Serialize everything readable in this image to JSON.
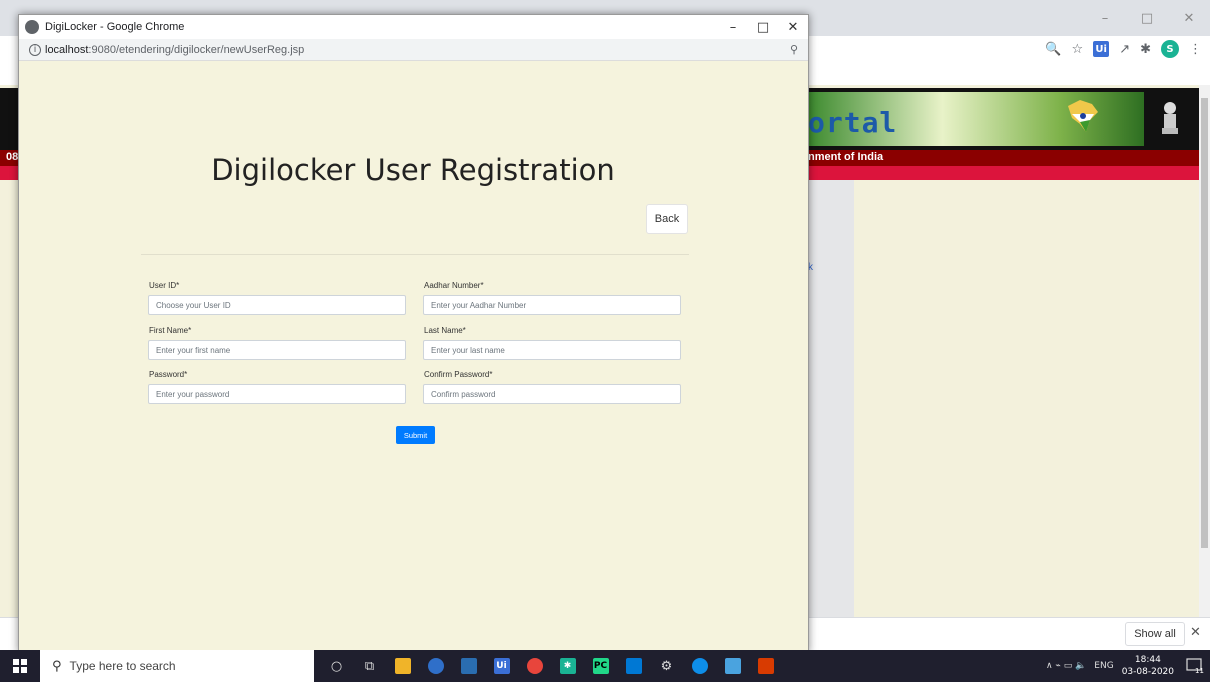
{
  "background_browser": {
    "window_controls": [
      "–",
      "□",
      "✕"
    ],
    "toolbar_icons": [
      "🔍",
      "☆",
      "Ui",
      "↗",
      "✱",
      "S",
      "⋮"
    ],
    "banner_text": "ortal",
    "gov_text": "nment of India",
    "left_clip": "08",
    "side_link": "k",
    "download_bar": {
      "show_all": "Show all",
      "close": "✕"
    }
  },
  "popup": {
    "title": "DigiLocker - Google Chrome",
    "controls": [
      "–",
      "□",
      "✕"
    ],
    "url_host": "localhost",
    "url_rest": ":9080/etendering/digilocker/newUserReg.jsp",
    "page_title": "Digilocker User Registration",
    "back_label": "Back",
    "form": {
      "user_id_label": "User ID*",
      "user_id_placeholder": "Choose your User ID",
      "aadhar_label": "Aadhar Number*",
      "aadhar_placeholder": "Enter your Aadhar Number",
      "first_name_label": "First Name*",
      "first_name_placeholder": "Enter your first name",
      "last_name_label": "Last Name*",
      "last_name_placeholder": "Enter your last name",
      "password_label": "Password*",
      "password_placeholder": "Enter your password",
      "confirm_password_label": "Confirm Password*",
      "confirm_password_placeholder": "Confirm password",
      "submit_label": "Submit"
    }
  },
  "taskbar": {
    "search_placeholder": "Type here to search",
    "apps": [
      "cortana",
      "task-view",
      "file-explorer",
      "edge",
      "sourcetree",
      "uipath",
      "chrome",
      "snow",
      "pycharm",
      "mail",
      "settings",
      "teamviewer",
      "notepad",
      "office"
    ],
    "tray_icons": "∧  ⌁  ▭  🔈",
    "language": "ENG",
    "time": "18:44",
    "date": "03-08-2020",
    "notification_count": "11"
  },
  "colors": {
    "page_bg": "#f5f3dd",
    "submit_blue": "#007bff",
    "red_bar": "#8b0000",
    "crimson_bar": "#dc143c"
  }
}
